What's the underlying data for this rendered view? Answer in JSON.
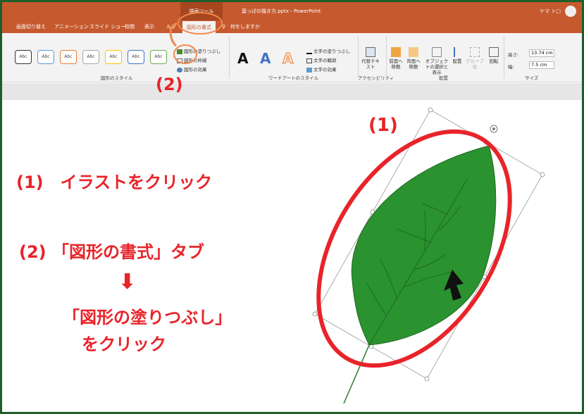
{
  "window": {
    "drawing_tools": "描画ツール",
    "document_title": "葉っぱの描き方.pptx - PowerPoint",
    "user_name": "ケマ ト□"
  },
  "tabs": [
    {
      "label": "画面切り替え"
    },
    {
      "label": "アニメーション"
    },
    {
      "label": "スライド ショー"
    },
    {
      "label": "校閲"
    },
    {
      "label": "表示"
    },
    {
      "label": "ルプ"
    },
    {
      "label": "図形の書式"
    },
    {
      "label": "何をしますか"
    }
  ],
  "ribbon": {
    "style_sample": "Abc",
    "shape_styles_label": "図形のスタイル",
    "shape_fill": "図形の塗りつぶし",
    "shape_outline": "図形の枠線",
    "shape_effects": "図形の効果",
    "wordart_letter": "A",
    "text_fill": "文字の塗りつぶし",
    "text_outline": "文字の輪郭",
    "text_effects": "文字の効果",
    "wordart_styles_label": "ワードアートのスタイル",
    "alt_text": "代替テキスト",
    "accessibility_label": "アクセシビリティ",
    "bring_forward": "前面へ移動",
    "send_backward": "背面へ移動",
    "selection_pane": "オブジェクトの選択と表示",
    "align": "配置",
    "group": "グループ化",
    "rotate": "回転",
    "arrange_label": "配置",
    "height_label": "高さ:",
    "height_value": "13.74 cm",
    "width_label": "幅:",
    "width_value": "7.5 cm",
    "size_label": "サイズ"
  },
  "annotations": {
    "marker_1": "(1)",
    "marker_2": "(2)",
    "step1": "(1)　イラストをクリック",
    "step2": "(2) 「図形の書式」タブ",
    "step2_arrow": "⬇",
    "step2_line2": "「図形の塗りつぶし」",
    "step2_line3": "をクリック"
  },
  "colors": {
    "ribbon_accent": "#c65a2e",
    "annotation_red": "#e8242a",
    "highlight_orange": "#f08a4b",
    "leaf_green": "#2a922f",
    "frame_green": "#1e5e2a"
  }
}
